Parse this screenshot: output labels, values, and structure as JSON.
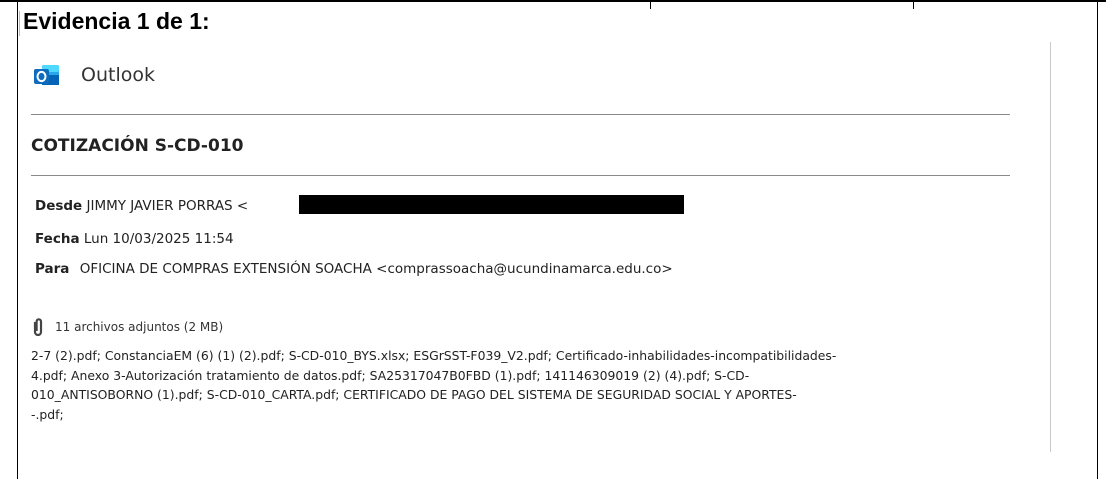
{
  "evidence": {
    "title": "Evidencia 1 de 1:"
  },
  "outlook": {
    "app_name": "Outlook",
    "icon": "outlook-icon"
  },
  "email": {
    "subject": "COTIZACIÓN S-CD-010",
    "from_label": "Desde",
    "from_value": "JIMMY JAVIER PORRAS <",
    "date_label": "Fecha",
    "date_value": "Lun 10/03/2025 11:54",
    "to_label": "Para",
    "to_value": "OFICINA DE COMPRAS EXTENSIÓN SOACHA <comprassoacha@ucundinamarca.edu.co>",
    "attachments_summary": "11 archivos adjuntos (2 MB)",
    "attachments_icon": "paperclip-icon",
    "attachments_lines": [
      "2-7 (2).pdf; ConstanciaEM (6) (1) (2).pdf; S-CD-010_BYS.xlsx; ESGrSST-F039_V2.pdf; Certificado-inhabilidades-incompatibilidades-",
      "4.pdf; Anexo 3-Autorización tratamiento de datos.pdf; SA25317047B0FBD (1).pdf; 141146309019 (2) (4).pdf; S-CD-",
      "010_ANTISOBORNO (1).pdf; S-CD-010_CARTA.pdf; CERTIFICADO DE PAGO DEL SISTEMA DE SEGURIDAD SOCIAL Y APORTES-",
      "-.pdf;"
    ]
  },
  "colors": {
    "outlook_blue": "#0f6cbd",
    "outlook_light": "#28a8ea",
    "redaction": "#000000"
  }
}
